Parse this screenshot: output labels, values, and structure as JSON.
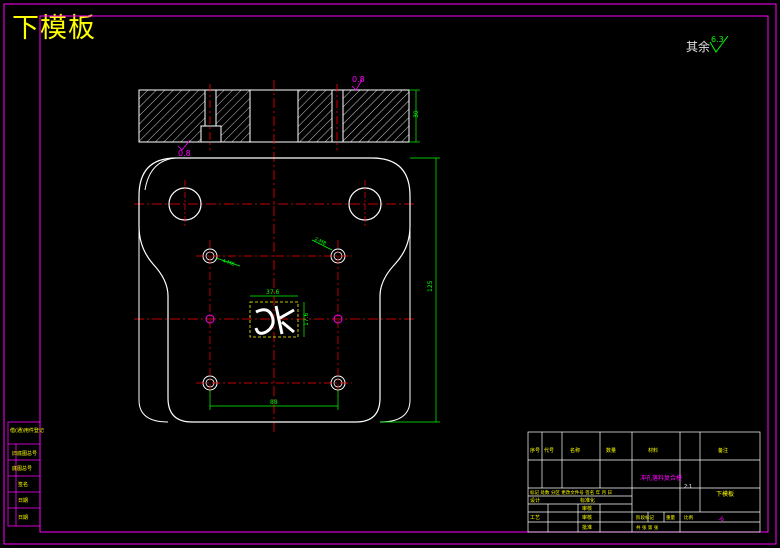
{
  "drawing": {
    "title": "下模板",
    "roughness_note": "其余",
    "roughness_value": "6.3"
  },
  "side_view": {
    "roughness_top": "0.8",
    "roughness_side": "0.8",
    "dim_height": "30"
  },
  "plan_view": {
    "dim_width": "88",
    "dim_height": "125",
    "dim_cavity_width": "37.6",
    "dim_cavity_height": "17.6",
    "hole_note_left": "4-M8",
    "hole_note_right": "2-M8"
  },
  "left_stamp": {
    "rows": [
      "借(通)用件登记",
      "旧底图总号",
      "底图总号",
      "签名",
      "日期",
      "日期"
    ]
  },
  "title_block": {
    "hdr_seq": "序号",
    "hdr_code": "代号",
    "hdr_name": "名称",
    "hdr_qty": "数量",
    "hdr_material": "材料",
    "hdr_remark": "备注",
    "project": "冲孔落料复合模",
    "part_name": "下模板",
    "row_revision": "标记 处数 分区 更改文件号 签名 年 月 日",
    "design": "设计",
    "standard": "标准化",
    "stage_mark": "阶段标记",
    "weight": "重量",
    "scale": "比例",
    "scale_value": "2:1",
    "process": "工艺",
    "review": "审核",
    "approve": "批准",
    "sheet": "共 张 第 张",
    "drawing_no": "-6",
    "check": "审核"
  },
  "colors": {
    "frame": "#ff00ff",
    "outline": "#ffffff",
    "centerline": "#ff0000",
    "dimension": "#00ff00",
    "title": "#ffff00"
  }
}
